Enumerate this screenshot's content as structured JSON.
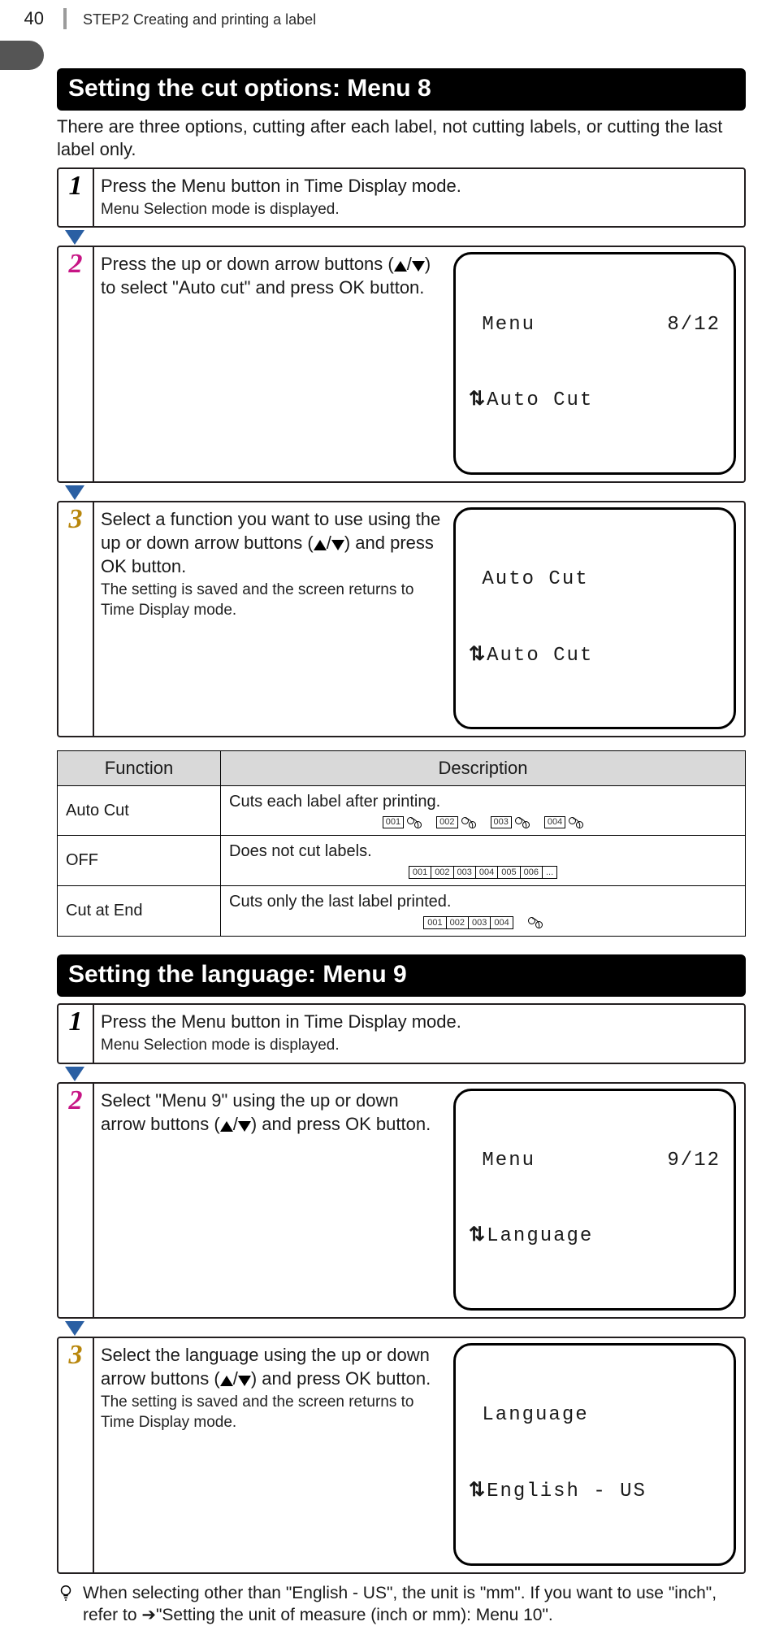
{
  "page_number": "40",
  "breadcrumb": "STEP2 Creating and printing a label",
  "section1": {
    "title": "Setting the cut options: Menu 8",
    "intro": "There are three options, cutting after each label, not cutting labels, or cutting the last label only.",
    "steps": [
      {
        "num": "1",
        "text": "Press the Menu button in Time Display mode.",
        "sub": "Menu Selection mode is displayed."
      },
      {
        "num": "2",
        "text": "Press the up or down arrow buttons (▲/▼) to select \"Auto cut\" and press OK button.",
        "lcd": {
          "l1_left": " Menu",
          "l1_right": "8/12",
          "l2": "Auto Cut"
        }
      },
      {
        "num": "3",
        "text": "Select a function you want to use using the up or down arrow buttons (▲/▼) and press OK button.",
        "sub": "The setting is saved and the screen returns to Time Display mode.",
        "lcd": {
          "l1_left": " Auto Cut",
          "l1_right": "",
          "l2": "Auto Cut"
        }
      }
    ],
    "table": {
      "head": {
        "c1": "Function",
        "c2": "Description"
      },
      "rows": [
        {
          "name": "Auto Cut",
          "desc": "Cuts each label after printing.",
          "art": "cut_each",
          "labels": [
            "001",
            "002",
            "003",
            "004"
          ]
        },
        {
          "name": "OFF",
          "desc": "Does not cut labels.",
          "art": "strip",
          "labels": [
            "001",
            "002",
            "003",
            "004",
            "005",
            "006",
            "..."
          ]
        },
        {
          "name": "Cut at End",
          "desc": "Cuts only the last label printed.",
          "art": "cut_end",
          "labels": [
            "001",
            "002",
            "003",
            "004"
          ]
        }
      ]
    }
  },
  "section2": {
    "title": "Setting the language: Menu 9",
    "steps": [
      {
        "num": "1",
        "text": "Press the Menu button in Time Display mode.",
        "sub": "Menu Selection mode is displayed."
      },
      {
        "num": "2",
        "text": "Select \"Menu 9\" using the up or down arrow buttons (▲/▼) and press OK button.",
        "lcd": {
          "l1_left": " Menu",
          "l1_right": "9/12",
          "l2": "Language"
        }
      },
      {
        "num": "3",
        "text": "Select the language using the up or down arrow buttons (▲/▼) and press OK button.",
        "sub": "The setting is saved and the screen returns to Time Display mode.",
        "lcd": {
          "l1_left": " Language",
          "l1_right": "",
          "l2": "English - US"
        }
      }
    ],
    "note": "When selecting other than \"English - US\", the unit is \"mm\". If you want to use \"inch\", refer to ➔\"Setting the unit of measure (inch or mm): Menu 10\"."
  }
}
